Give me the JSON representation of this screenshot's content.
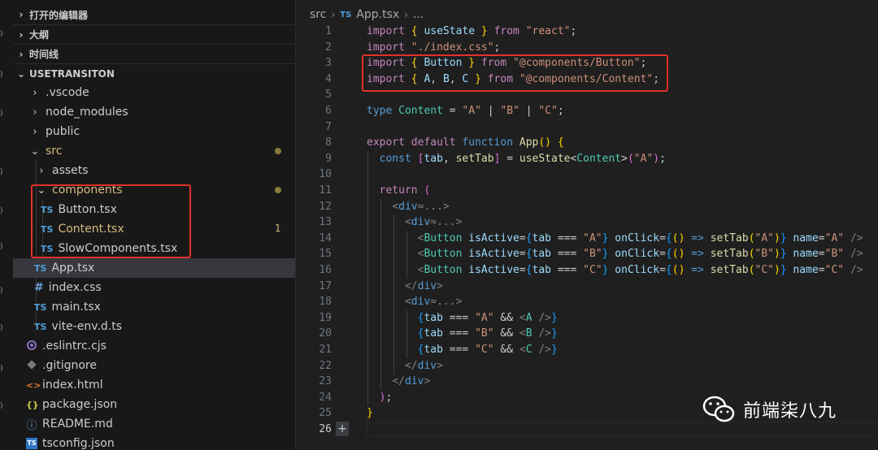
{
  "sidebar": {
    "sections": {
      "open_editors": "打开的编辑器",
      "outline": "大纲",
      "timeline": "时间线",
      "project": "USETRANSITON"
    },
    "tree": [
      {
        "label": ".vscode",
        "icon": "chevron-right-icon"
      },
      {
        "label": "node_modules",
        "icon": "chevron-right-icon"
      },
      {
        "label": "public",
        "icon": "chevron-right-icon"
      },
      {
        "label": "src",
        "icon": "chevron-down-icon",
        "status": "modified-dot"
      },
      {
        "label": "assets",
        "icon": "chevron-right-icon"
      },
      {
        "label": "components",
        "icon": "chevron-down-icon",
        "status": "modified-dot"
      },
      {
        "label": "Button.tsx",
        "icon": "ts-file-icon",
        "icon_text": "TS"
      },
      {
        "label": "Content.tsx",
        "icon": "ts-file-icon",
        "icon_text": "TS",
        "badge": "1"
      },
      {
        "label": "SlowComponents.tsx",
        "icon": "ts-file-icon",
        "icon_text": "TS"
      },
      {
        "label": "App.tsx",
        "icon": "ts-file-icon",
        "icon_text": "TS",
        "selected": true
      },
      {
        "label": "index.css",
        "icon": "css-hash-icon",
        "icon_text": "#"
      },
      {
        "label": "main.tsx",
        "icon": "ts-file-icon",
        "icon_text": "TS"
      },
      {
        "label": "vite-env.d.ts",
        "icon": "ts-file-icon",
        "icon_text": "TS"
      },
      {
        "label": ".eslintrc.cjs",
        "icon": "eslint-icon"
      },
      {
        "label": ".gitignore",
        "icon": "git-icon"
      },
      {
        "label": "index.html",
        "icon": "html-icon",
        "icon_text": "<>"
      },
      {
        "label": "package.json",
        "icon": "json-icon",
        "icon_text": "{}"
      },
      {
        "label": "README.md",
        "icon": "info-icon",
        "icon_text": "ⓘ"
      },
      {
        "label": "tsconfig.json",
        "icon": "tsconfig-icon",
        "icon_text": "TS"
      }
    ]
  },
  "breadcrumb": {
    "folder": "src",
    "file_icon": "TS",
    "file": "App.tsx",
    "more": "..."
  },
  "editor": {
    "line_numbers": [
      "1",
      "2",
      "3",
      "4",
      "5",
      "6",
      "7",
      "8",
      "9",
      "10",
      "11",
      "12",
      "13",
      "14",
      "15",
      "16",
      "17",
      "18",
      "19",
      "20",
      "21",
      "22",
      "23",
      "24",
      "25",
      "26"
    ],
    "active_line": "26",
    "add_button": "+"
  },
  "watermark": {
    "text": "前端柒八九"
  },
  "colors": {
    "highlight_box": "#e0312a",
    "keyword": "#c586c0",
    "string": "#ce9178",
    "variable": "#9cdcfe",
    "function": "#dcdcaa",
    "type": "#4ec9b0",
    "ts_icon": "#4d9ed8",
    "modified": "#d7ba7d"
  }
}
